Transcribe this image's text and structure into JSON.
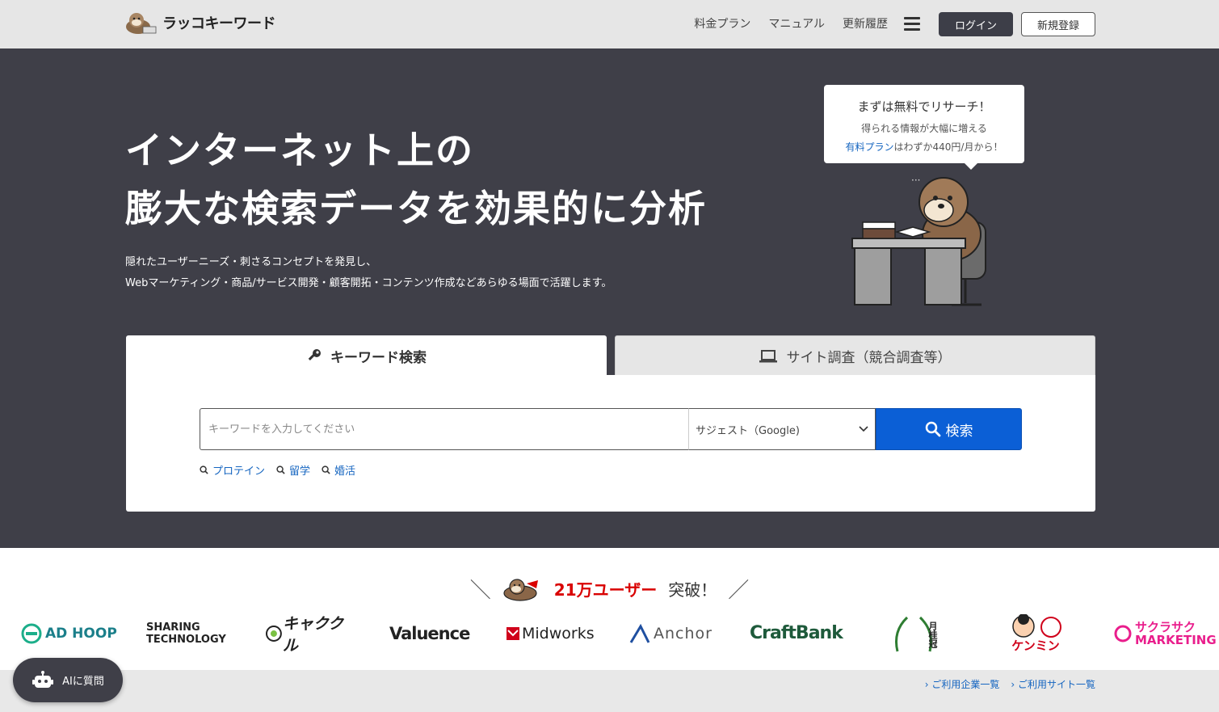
{
  "header": {
    "logo_text": "ラッコキーワード",
    "nav": [
      "料金プラン",
      "マニュアル",
      "更新履歴"
    ],
    "login_label": "ログイン",
    "signup_label": "新規登録"
  },
  "hero": {
    "title_line1": "インターネット上の",
    "title_line2": "膨大な検索データを効果的に分析",
    "sub_line1": "隠れたユーザーニーズ・刺さるコンセプトを発見し、",
    "sub_line2": "Webマーケティング・商品/サービス開発・顧客開拓・コンテンツ作成などあらゆる場面で活躍します。",
    "bubble": {
      "line1": "まずは無料でリサーチ！",
      "line2": "得られる情報が大幅に増える",
      "line3_link": "有料プラン",
      "line3_rest": "はわずか440円/月から！"
    }
  },
  "search": {
    "tab_keyword": "キーワード検索",
    "tab_site": "サイト調査（競合調査等）",
    "placeholder": "キーワードを入力してください",
    "select_value": "サジェスト（Google)",
    "button_label": "検索",
    "suggestions": [
      "プロテイン",
      "留学",
      "婚活"
    ]
  },
  "users": {
    "count_text": "21万ユーザー",
    "suffix": "突破！",
    "companies": [
      "AD HOOP",
      "SHARING TECHNOLOGY",
      "キャククル",
      "Valuence",
      "Midworks",
      "Anchor",
      "CraftBank",
      "月桂冠",
      "ケンミン",
      "サクラサク MARKETING"
    ]
  },
  "footer_links": [
    "ご利用企業一覧",
    "ご利用サイト一覧"
  ],
  "ai_button": "AIに質問",
  "colors": {
    "hero_bg": "#3f3f48",
    "accent_blue": "#0b5fd6",
    "red": "#d90000"
  }
}
